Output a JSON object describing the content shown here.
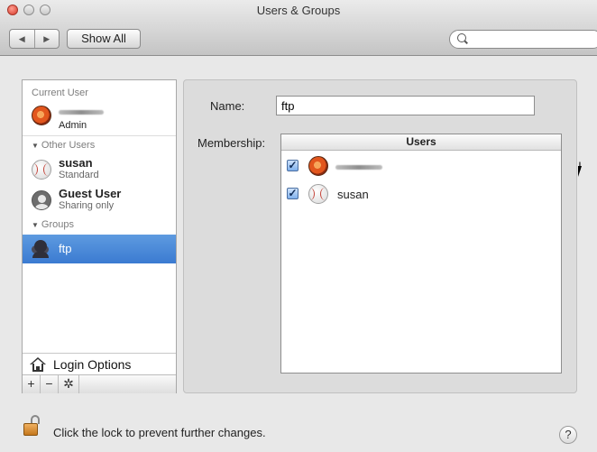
{
  "window": {
    "title": "Users & Groups"
  },
  "toolbar": {
    "back_glyph": "◀",
    "forward_glyph": "▶",
    "show_all_label": "Show All",
    "search_placeholder": ""
  },
  "sidebar": {
    "current_user_header": "Current User",
    "current_user": {
      "role": "Admin",
      "icon": "flower-avatar-icon"
    },
    "other_users_header": "Other Users",
    "other_users": [
      {
        "name": "susan",
        "role": "Standard",
        "icon": "baseball-avatar-icon"
      },
      {
        "name": "Guest User",
        "role": "Sharing only",
        "icon": "guest-avatar-icon"
      }
    ],
    "groups_header": "Groups",
    "groups": [
      {
        "name": "ftp",
        "selected": true,
        "icon": "group-icon"
      }
    ],
    "login_options_label": "Login Options",
    "add_glyph": "+",
    "remove_glyph": "−",
    "action_glyph": "✲"
  },
  "detail": {
    "name_label": "Name:",
    "name_value": "ftp",
    "membership_label": "Membership:",
    "users_column_header": "Users",
    "members": [
      {
        "checked": true,
        "check_glyph": "✓",
        "icon": "flower-avatar-icon"
      },
      {
        "name": "susan",
        "checked": true,
        "check_glyph": "✓",
        "icon": "baseball-avatar-icon"
      }
    ]
  },
  "footer": {
    "lock_text": "Click the lock to prevent further changes.",
    "help_glyph": "?"
  },
  "colors": {
    "selection": "#3b7bd1",
    "window_bg": "#e8e8e8",
    "pane_bg": "#dcdcdc"
  }
}
